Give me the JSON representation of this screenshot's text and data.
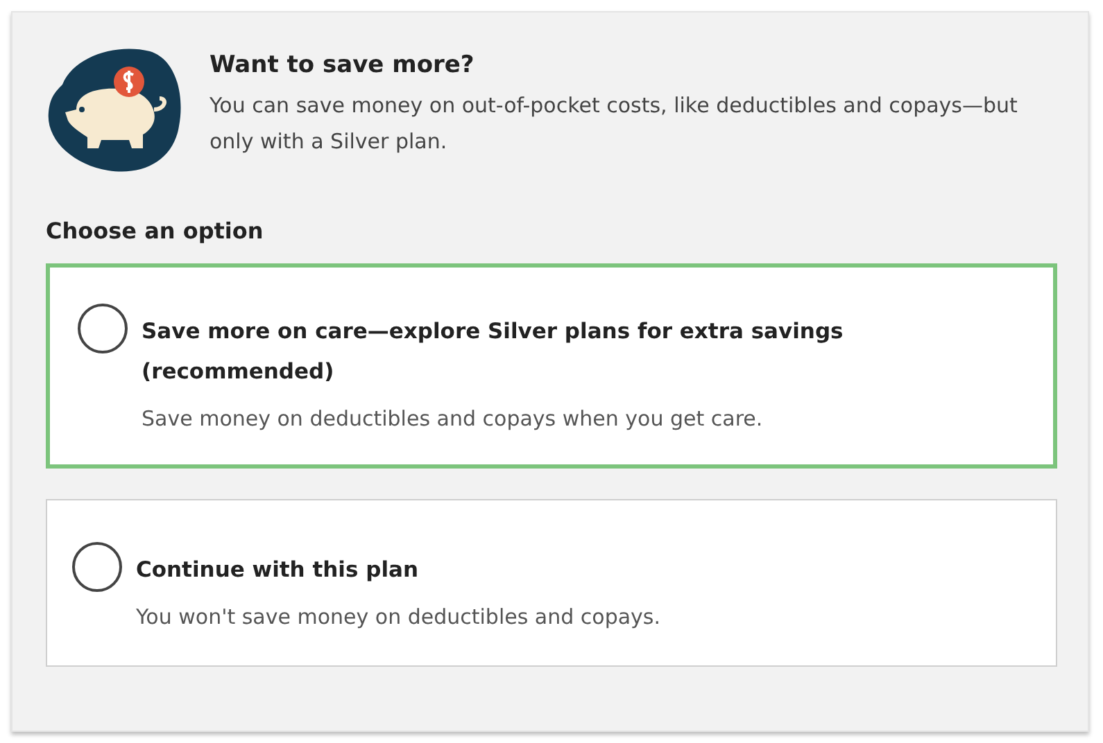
{
  "intro": {
    "title": "Want to save more?",
    "text": "You can save money on out-of-pocket costs, like deductibles and copays—but only with a Silver plan."
  },
  "options_heading": "Choose an option",
  "options": [
    {
      "label": "Save more on care—explore Silver plans for extra savings (recommended)",
      "description": "Save money on deductibles and copays when you get care.",
      "checked": false,
      "highlighted": true
    },
    {
      "label": "Continue with this plan",
      "description": "You won't save money on deductibles and copays.",
      "checked": false,
      "highlighted": false
    }
  ]
}
